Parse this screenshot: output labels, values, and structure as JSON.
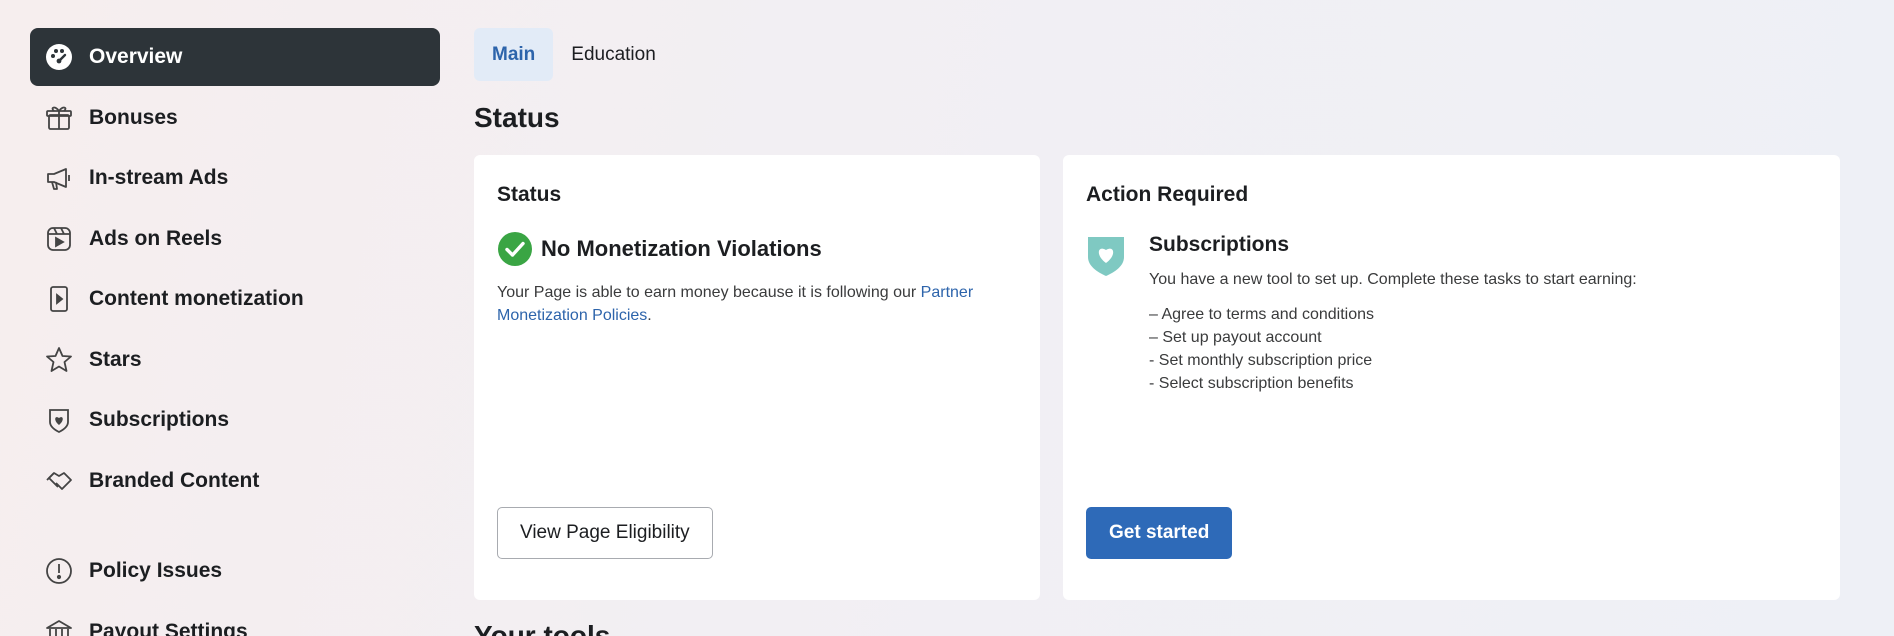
{
  "sidebar": {
    "items": [
      {
        "label": "Overview",
        "icon": "dashboard-icon",
        "active": true
      },
      {
        "label": "Bonuses",
        "icon": "gift-icon"
      },
      {
        "label": "In-stream Ads",
        "icon": "megaphone-icon"
      },
      {
        "label": "Ads on Reels",
        "icon": "reels-icon"
      },
      {
        "label": "Content monetization",
        "icon": "content-icon"
      },
      {
        "label": "Stars",
        "icon": "star-icon"
      },
      {
        "label": "Subscriptions",
        "icon": "heart-shield-icon"
      },
      {
        "label": "Branded Content",
        "icon": "handshake-icon"
      },
      {
        "label": "Policy Issues",
        "icon": "alert-icon"
      },
      {
        "label": "Payout Settings",
        "icon": "bank-icon"
      }
    ]
  },
  "tabs": [
    {
      "label": "Main",
      "active": true
    },
    {
      "label": "Education"
    }
  ],
  "status_section": {
    "title": "Status"
  },
  "status_card": {
    "title": "Status",
    "status_text": "No Monetization Violations",
    "desc": "Your Page is able to earn money because it is following our",
    "link": "Partner Monetization Policies",
    "link_suffix": ".",
    "button": "View Page Eligibility"
  },
  "action_card": {
    "title": "Action Required",
    "sub_title": "Subscriptions",
    "sub_desc": "You have a new tool to set up. Complete these tasks to start earning:",
    "tasks": [
      "– Agree to terms and conditions",
      "– Set up payout account",
      "- Set monthly subscription price",
      "- Select subscription benefits"
    ],
    "button": "Get started"
  },
  "next_section": {
    "title": "Your tools"
  },
  "colors": {
    "active_nav_bg": "#2d3439",
    "accent": "#2e6ab8",
    "success": "#3aa544",
    "shield": "#7fc9c2"
  }
}
